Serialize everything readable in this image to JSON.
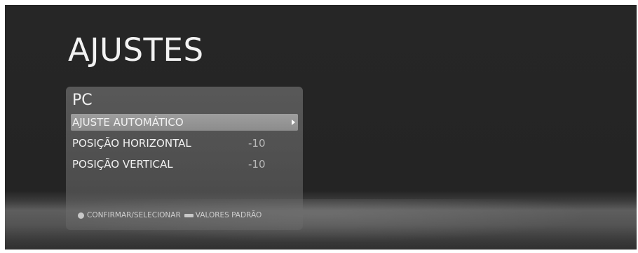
{
  "screen": {
    "title": "AJUSTES"
  },
  "panel": {
    "title": "PC",
    "items": [
      {
        "label": "AJUSTE AUTOMÁTICO",
        "value": "",
        "selected": true
      },
      {
        "label": "POSIÇÃO HORIZONTAL",
        "value": "-10",
        "selected": false
      },
      {
        "label": "POSIÇÃO VERTICAL",
        "value": "-10",
        "selected": false
      }
    ],
    "hints": {
      "confirm_label": "CONFIRMAR/SELECIONAR",
      "confirm_icon": "circle-button-icon",
      "defaults_label": "VALORES PADRÃO",
      "defaults_icon": "rect-button-icon"
    }
  },
  "colors": {
    "background": "#262626",
    "selected_row": "#969696",
    "text": "#f2f2f2",
    "value_text": "#b9b9b9"
  }
}
